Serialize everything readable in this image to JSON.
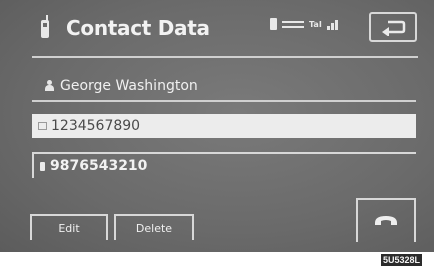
{
  "header": {
    "title": "Contact Data",
    "phone_icon": "phone-icon",
    "status": {
      "text": "TaI",
      "icons": [
        "phone-icon",
        "battery-icon",
        "signal-icon"
      ]
    },
    "back_icon": "back-arrow-icon"
  },
  "contact": {
    "name": "George Washington",
    "numbers": [
      {
        "icon": "home-icon",
        "value": "1234567890",
        "selected": true
      },
      {
        "icon": "mobile-icon",
        "value": "9876543210",
        "selected": false
      }
    ]
  },
  "actions": {
    "edit_label": "Edit",
    "delete_label": "Delete",
    "call_icon": "handset-icon"
  },
  "figure_code": "5U5328L",
  "colors": {
    "screen_bg": "#6f6f6f",
    "selected_field": "#ececec",
    "text": "#f0f0f0",
    "lines": "#d0d0d0"
  }
}
